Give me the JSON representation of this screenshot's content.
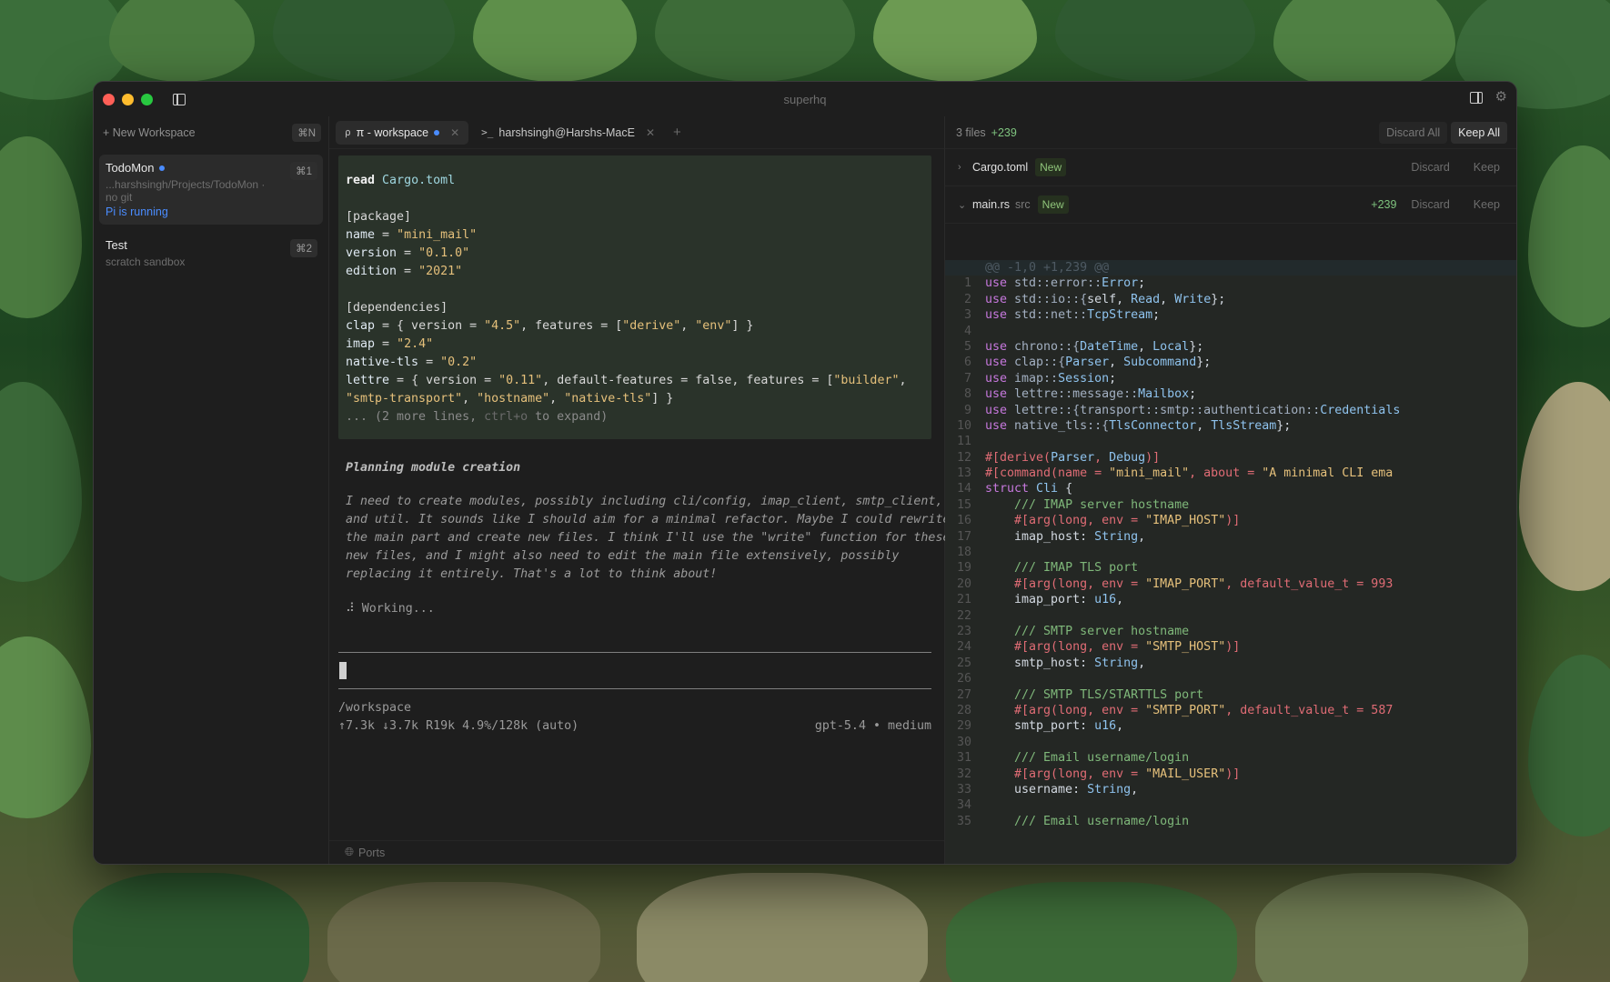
{
  "window": {
    "title": "superhq"
  },
  "sidebar": {
    "new_workspace_label": "+ New Workspace",
    "new_workspace_shortcut": "⌘N",
    "workspaces": [
      {
        "name": "TodoMon",
        "path": "...harshsingh/Projects/TodoMon · no git",
        "status": "Pi is running",
        "shortcut": "⌘1"
      },
      {
        "name": "Test",
        "path": "scratch sandbox",
        "shortcut": "⌘2"
      }
    ]
  },
  "tabs": [
    {
      "icon": "pi",
      "label": "π - workspace"
    },
    {
      "icon": ">_",
      "label": "harshsingh@Harshs-MacE"
    }
  ],
  "terminal": {
    "read_cmd": "read",
    "read_file": "Cargo.toml",
    "toml": {
      "package_header": "[package]",
      "name_key": "name",
      "name_val": "\"mini_mail\"",
      "version_key": "version",
      "version_val": "\"0.1.0\"",
      "edition_key": "edition",
      "edition_val": "\"2021\"",
      "deps_header": "[dependencies]",
      "clap_key": "clap",
      "clap_ver": "\"4.5\"",
      "clap_f1": "\"derive\"",
      "clap_f2": "\"env\"",
      "imap_key": "imap",
      "imap_val": "\"2.4\"",
      "ntls_key": "native-tls",
      "ntls_val": "\"0.2\"",
      "lettre_key": "lettre",
      "lettre_ver": "\"0.11\"",
      "lettre_f1": "\"builder\"",
      "lettre_f2": "\"smtp-transport\"",
      "lettre_f3": "\"hostname\"",
      "lettre_f4": "\"native-tls\"",
      "more": "... (2 more lines, ",
      "more_key": "ctrl+o",
      "more_tail": " to expand)"
    },
    "thinking_heading": "Planning module creation",
    "thinking_text": "I need to create modules, possibly including cli/config, imap_client, smtp_client,\nand util. It sounds like I should aim for a minimal refactor. Maybe I could rewrite\nthe main part and create new files. I think I'll use the \"write\" function for these\nnew files, and I might also need to edit the main file extensively, possibly\nreplacing it entirely. That's a lot to think about!",
    "working": "⠼ Working...",
    "cwd": "/workspace",
    "stats": "↑7.3k ↓3.7k R19k 4.9%/128k (auto)",
    "model": "gpt-5.4 • medium",
    "ports_label": "Ports"
  },
  "diff": {
    "files_count": "3 files",
    "additions": "+239",
    "discard_all": "Discard All",
    "keep_all": "Keep All",
    "files": [
      {
        "name": "Cargo.toml",
        "dir": "",
        "badge": "New",
        "adds": "",
        "discard": "Discard",
        "keep": "Keep"
      },
      {
        "name": "main.rs",
        "dir": "src",
        "badge": "New",
        "adds": "+239",
        "discard": "Discard",
        "keep": "Keep"
      }
    ],
    "hunk": "@@ -1,0 +1,239 @@"
  },
  "code_lines": [
    [
      [
        "ck",
        "use "
      ],
      [
        "cp",
        "std::error::"
      ],
      [
        "ctype",
        "Error"
      ],
      [
        "ct",
        ";"
      ]
    ],
    [
      [
        "ck",
        "use "
      ],
      [
        "cp",
        "std::io::{"
      ],
      [
        "ct",
        "self, "
      ],
      [
        "ctype",
        "Read"
      ],
      [
        "ct",
        ", "
      ],
      [
        "ctype",
        "Write"
      ],
      [
        "ct",
        "};"
      ]
    ],
    [
      [
        "ck",
        "use "
      ],
      [
        "cp",
        "std::net::"
      ],
      [
        "ctype",
        "TcpStream"
      ],
      [
        "ct",
        ";"
      ]
    ],
    [],
    [
      [
        "ck",
        "use "
      ],
      [
        "cp",
        "chrono::{"
      ],
      [
        "ctype",
        "DateTime"
      ],
      [
        "ct",
        ", "
      ],
      [
        "ctype",
        "Local"
      ],
      [
        "ct",
        "};"
      ]
    ],
    [
      [
        "ck",
        "use "
      ],
      [
        "cp",
        "clap::{"
      ],
      [
        "ctype",
        "Parser"
      ],
      [
        "ct",
        ", "
      ],
      [
        "ctype",
        "Subcommand"
      ],
      [
        "ct",
        "};"
      ]
    ],
    [
      [
        "ck",
        "use "
      ],
      [
        "cp",
        "imap::"
      ],
      [
        "ctype",
        "Session"
      ],
      [
        "ct",
        ";"
      ]
    ],
    [
      [
        "ck",
        "use "
      ],
      [
        "cp",
        "lettre::message::"
      ],
      [
        "ctype",
        "Mailbox"
      ],
      [
        "ct",
        ";"
      ]
    ],
    [
      [
        "ck",
        "use "
      ],
      [
        "cp",
        "lettre::{transport::smtp::authentication::"
      ],
      [
        "ctype",
        "Credentials"
      ]
    ],
    [
      [
        "ck",
        "use "
      ],
      [
        "cp",
        "native_tls::{"
      ],
      [
        "ctype",
        "TlsConnector"
      ],
      [
        "ct",
        ", "
      ],
      [
        "ctype",
        "TlsStream"
      ],
      [
        "ct",
        "};"
      ]
    ],
    [],
    [
      [
        "cattr",
        "#[derive("
      ],
      [
        "ctype",
        "Parser"
      ],
      [
        "cattr",
        ", "
      ],
      [
        "ctype",
        "Debug"
      ],
      [
        "cattr",
        ")]"
      ]
    ],
    [
      [
        "cattr",
        "#[command(name = "
      ],
      [
        "cstr",
        "\"mini_mail\""
      ],
      [
        "cattr",
        ", about = "
      ],
      [
        "cstr",
        "\"A minimal CLI ema"
      ]
    ],
    [
      [
        "ck",
        "struct "
      ],
      [
        "ctype",
        "Cli"
      ],
      [
        "ct",
        " {"
      ]
    ],
    [
      [
        "ct",
        "    "
      ],
      [
        "ccom",
        "/// IMAP server hostname"
      ]
    ],
    [
      [
        "ct",
        "    "
      ],
      [
        "cattr",
        "#[arg(long, env = "
      ],
      [
        "cstr",
        "\"IMAP_HOST\""
      ],
      [
        "cattr",
        ")]"
      ]
    ],
    [
      [
        "ct",
        "    imap_host: "
      ],
      [
        "ctype",
        "String"
      ],
      [
        "ct",
        ","
      ]
    ],
    [],
    [
      [
        "ct",
        "    "
      ],
      [
        "ccom",
        "/// IMAP TLS port"
      ]
    ],
    [
      [
        "ct",
        "    "
      ],
      [
        "cattr",
        "#[arg(long, env = "
      ],
      [
        "cstr",
        "\"IMAP_PORT\""
      ],
      [
        "cattr",
        ", default_value_t = 993"
      ]
    ],
    [
      [
        "ct",
        "    imap_port: "
      ],
      [
        "ctype",
        "u16"
      ],
      [
        "ct",
        ","
      ]
    ],
    [],
    [
      [
        "ct",
        "    "
      ],
      [
        "ccom",
        "/// SMTP server hostname"
      ]
    ],
    [
      [
        "ct",
        "    "
      ],
      [
        "cattr",
        "#[arg(long, env = "
      ],
      [
        "cstr",
        "\"SMTP_HOST\""
      ],
      [
        "cattr",
        ")]"
      ]
    ],
    [
      [
        "ct",
        "    smtp_host: "
      ],
      [
        "ctype",
        "String"
      ],
      [
        "ct",
        ","
      ]
    ],
    [],
    [
      [
        "ct",
        "    "
      ],
      [
        "ccom",
        "/// SMTP TLS/STARTTLS port"
      ]
    ],
    [
      [
        "ct",
        "    "
      ],
      [
        "cattr",
        "#[arg(long, env = "
      ],
      [
        "cstr",
        "\"SMTP_PORT\""
      ],
      [
        "cattr",
        ", default_value_t = 587"
      ]
    ],
    [
      [
        "ct",
        "    smtp_port: "
      ],
      [
        "ctype",
        "u16"
      ],
      [
        "ct",
        ","
      ]
    ],
    [],
    [
      [
        "ct",
        "    "
      ],
      [
        "ccom",
        "/// Email username/login"
      ]
    ],
    [
      [
        "ct",
        "    "
      ],
      [
        "cattr",
        "#[arg(long, env = "
      ],
      [
        "cstr",
        "\"MAIL_USER\""
      ],
      [
        "cattr",
        ")]"
      ]
    ],
    [
      [
        "ct",
        "    username: "
      ],
      [
        "ctype",
        "String"
      ],
      [
        "ct",
        ","
      ]
    ],
    [],
    [
      [
        "ct",
        "    "
      ],
      [
        "ccom",
        "/// Email username/login"
      ]
    ]
  ],
  "colors": {
    "accent_blue": "#4a8cff",
    "added_green": "#7fc47f",
    "close": "#ff5f57",
    "minimize": "#febc2e",
    "maximize": "#28c840"
  }
}
